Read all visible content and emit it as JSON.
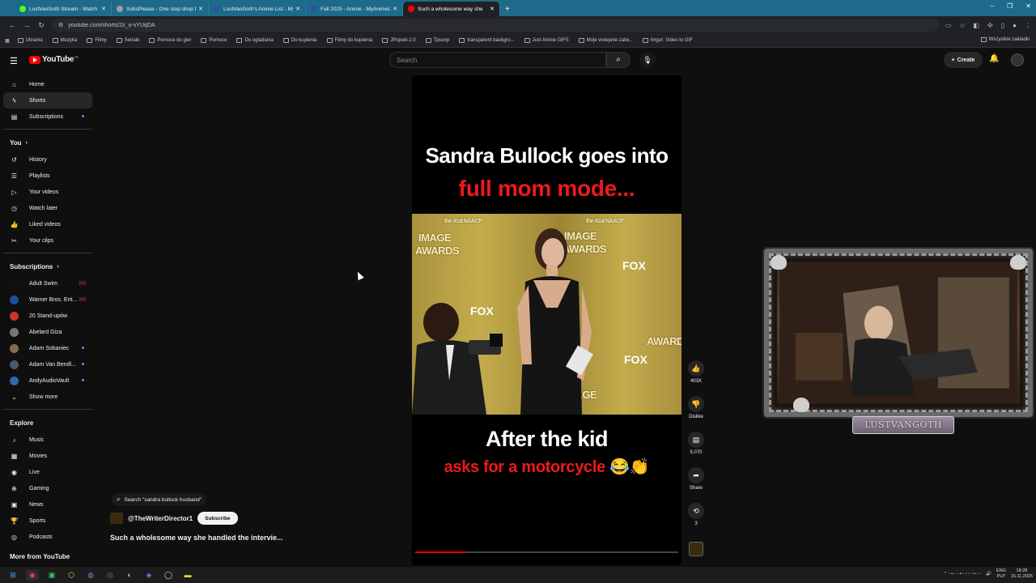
{
  "browser": {
    "tabs": [
      {
        "title": "LustVanGoth Stream - Watch L",
        "color": "#53fc18"
      },
      {
        "title": "SubsPlease - One stop shop fo",
        "color": "#9aa0a6"
      },
      {
        "title": "LustVanGoth's Anime List - My",
        "color": "#2e51a2"
      },
      {
        "title": "Fall 2025 - Anime - MyAnimeLi",
        "color": "#2e51a2"
      },
      {
        "title": "Such a wholesome way she",
        "color": "#ff0000",
        "active": true
      }
    ],
    "url": "youtube.com/shorts/2z_o-vYUqDA",
    "bookmarks": [
      "Ubrania",
      "Muzyka",
      "Filmy",
      "Seriale",
      "Pomoce do gier",
      "Pomoce",
      "Do ogladania",
      "Do kupienia",
      "Filmy do kupienia",
      "JPopuki 2.0",
      "Tpcexp",
      "transparent backgro...",
      "Just Anime GIFS",
      "Moje wstepnie zatw...",
      "Imgur: Video to GIF"
    ],
    "bookmarks_right": "Wszystkie zakładki"
  },
  "youtube": {
    "logo": "YouTube",
    "country": "PL",
    "search_placeholder": "Search",
    "create_label": "Create"
  },
  "sidebar": {
    "main": [
      {
        "label": "Home",
        "icon": "home-icon",
        "glyph": "⌂"
      },
      {
        "label": "Shorts",
        "icon": "shorts-icon",
        "glyph": "ϟ",
        "active": true
      },
      {
        "label": "Subscriptions",
        "icon": "subscriptions-icon",
        "glyph": "▤",
        "dot": true
      }
    ],
    "you_header": "You",
    "you": [
      {
        "label": "History",
        "icon": "history-icon",
        "glyph": "↺"
      },
      {
        "label": "Playlists",
        "icon": "playlists-icon",
        "glyph": "☰"
      },
      {
        "label": "Your videos",
        "icon": "your-videos-icon",
        "glyph": "▷"
      },
      {
        "label": "Watch later",
        "icon": "watch-later-icon",
        "glyph": "◷"
      },
      {
        "label": "Liked videos",
        "icon": "liked-videos-icon",
        "glyph": "👍"
      },
      {
        "label": "Your clips",
        "icon": "clips-icon",
        "glyph": "✂"
      }
    ],
    "subs_header": "Subscriptions",
    "subs": [
      {
        "label": "Adult Swim",
        "live": true,
        "color": "#111111"
      },
      {
        "label": "Warner Bros. Ent...",
        "live": true,
        "color": "#1d4f9c"
      },
      {
        "label": "20 Stand-upów",
        "live": false,
        "color": "#cc3333"
      },
      {
        "label": "Abelard Giza",
        "live": false,
        "color": "#777777"
      },
      {
        "label": "Adam Sobaniec",
        "live": false,
        "dot": true,
        "color": "#8a6a4a"
      },
      {
        "label": "Adam Van Bendl...",
        "live": false,
        "dot": true,
        "color": "#4a5a6a"
      },
      {
        "label": "AndyAudioVault",
        "live": false,
        "dot": true,
        "color": "#3366aa"
      }
    ],
    "show_more": "Show more",
    "explore_header": "Explore",
    "explore": [
      {
        "label": "Music",
        "icon": "music-icon",
        "glyph": "♪"
      },
      {
        "label": "Movies",
        "icon": "movies-icon",
        "glyph": "▦"
      },
      {
        "label": "Live",
        "icon": "live-icon",
        "glyph": "◉"
      },
      {
        "label": "Gaming",
        "icon": "gaming-icon",
        "glyph": "⊕"
      },
      {
        "label": "News",
        "icon": "news-icon",
        "glyph": "▣"
      },
      {
        "label": "Sports",
        "icon": "sports-icon",
        "glyph": "🏆"
      },
      {
        "label": "Podcasts",
        "icon": "podcasts-icon",
        "glyph": "◎"
      }
    ],
    "more_from": "More from YouTube"
  },
  "short": {
    "caption_top_white": "Sandra Bullock goes into",
    "caption_top_red": "full mom mode...",
    "caption_bottom_white": "After the kid",
    "caption_bottom_red": "asks for a motorcycle 😂👏",
    "backdrop_text": [
      "IMAGE",
      "AWARDS",
      "the 41st NAACP",
      "FOX"
    ],
    "progress": 0.19,
    "search_suggestion": "Search \"sandra bullock husband\"",
    "channel": "@TheWriterDirector1",
    "subscribe_label": "Subscribe",
    "title": "Such a wholesome way she handled the intervie..."
  },
  "actions": {
    "like_count": "401K",
    "dislike_label": "Dislike",
    "comment_count": "5,070",
    "share_label": "Share",
    "remix_count": "3"
  },
  "webcam": {
    "badge": "LUSTVANGOTH"
  },
  "taskbar": {
    "lang": "ENG",
    "layout": "PLP",
    "time": "18:28",
    "date": "15.11.2025"
  }
}
